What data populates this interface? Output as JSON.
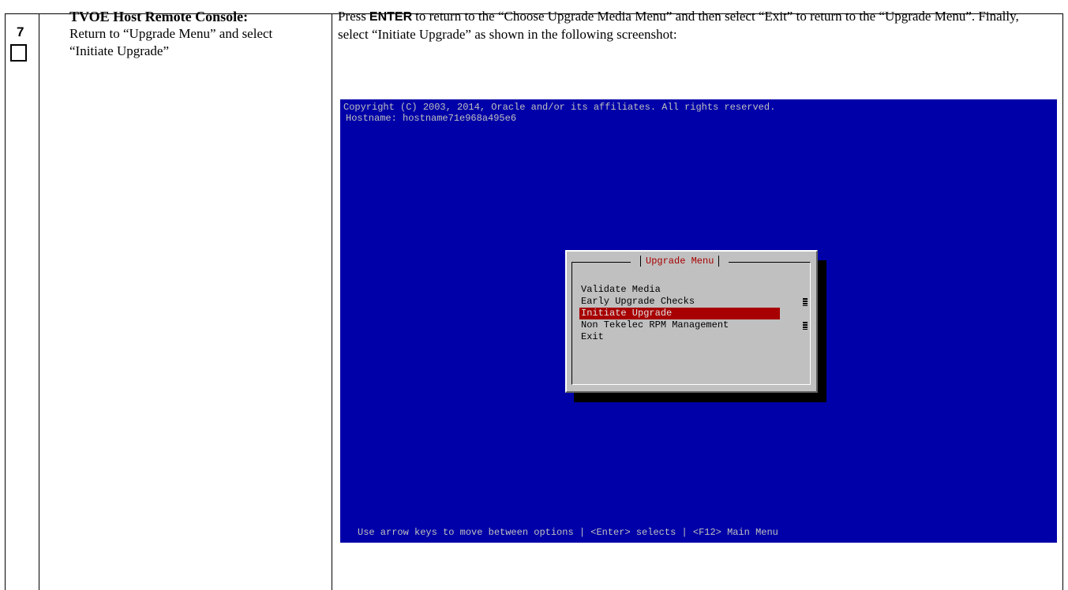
{
  "step": {
    "number": "7"
  },
  "description": {
    "title": "TVOE Host Remote Console:",
    "text": "Return to “Upgrade Menu” and select “Initiate Upgrade”"
  },
  "instruction": {
    "prefix": "Press",
    "key": "ENTER",
    "suffix": "to return to the “Choose Upgrade Media Menu” and then select “Exit” to return to the “Upgrade Menu”. Finally, select “Initiate Upgrade” as shown in the following screenshot:"
  },
  "console": {
    "copyright": "Copyright (C) 2003, 2014, Oracle and/or its affiliates. All rights reserved.",
    "hostname": "Hostname: hostname71e968a495e6",
    "status_line": "Use arrow keys to move between options | <Enter> selects | <F12> Main Menu",
    "menu": {
      "title": "Upgrade Menu",
      "items": [
        {
          "label": "Validate Media",
          "selected": false
        },
        {
          "label": "Early Upgrade Checks",
          "selected": false
        },
        {
          "label": "Initiate Upgrade",
          "selected": true
        },
        {
          "label": "Non Tekelec RPM Management",
          "selected": false
        },
        {
          "label": "Exit",
          "selected": false
        }
      ]
    },
    "colors": {
      "background": "#0000a8",
      "menu_bg": "#c0c0c0",
      "highlight": "#a80000"
    }
  }
}
